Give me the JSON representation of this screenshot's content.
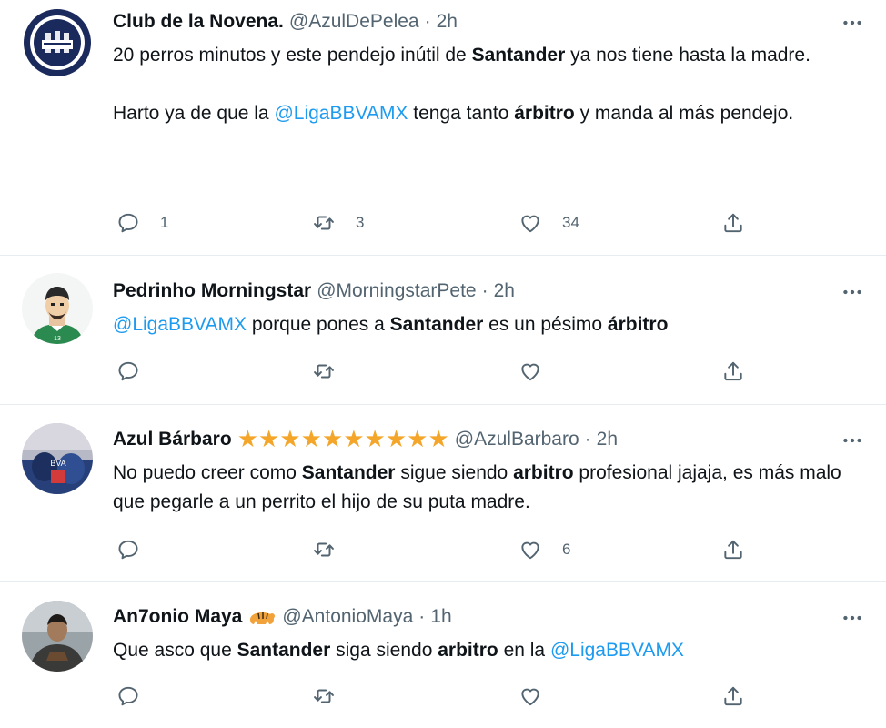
{
  "colors": {
    "text": "#0f1419",
    "secondary": "#536471",
    "link": "#1d9bf0",
    "divider": "#e6ecf0",
    "star": "#f4a62a"
  },
  "tweets": [
    {
      "name": "Club de la Novena.",
      "handle": "@AzulDePelea",
      "dot": "·",
      "time": "2h",
      "text": [
        [
          "20 perros minutos y este pendejo inútil de ",
          "Santander",
          " ya nos tiene hasta la madre."
        ],
        [
          "Harto ya de que la ",
          "@LigaBBVAMX",
          " tenga tanto ",
          "árbitro",
          " y manda al más pendejo."
        ]
      ],
      "counts": {
        "reply": "1",
        "retweet": "3",
        "like": "34"
      }
    },
    {
      "name": "Pedrinho Morningstar",
      "handle": "@MorningstarPete",
      "dot": "·",
      "time": "2h",
      "text": [
        "@LigaBBVAMX",
        " porque pones a ",
        "Santander",
        " es un pésimo ",
        "árbitro"
      ],
      "counts": {
        "reply": "",
        "retweet": "",
        "like": ""
      }
    },
    {
      "name": "Azul Bárbaro",
      "stars": "★★★★★★★★★★",
      "handle": "@AzulBarbaro",
      "dot": "·",
      "time": "2h",
      "text": [
        "No puedo creer como ",
        "Santander",
        " sigue siendo ",
        "arbitro",
        " profesional jajaja, es más malo que pegarle a un perrito el hijo de su puta madre."
      ],
      "counts": {
        "reply": "",
        "retweet": "",
        "like": "6"
      }
    },
    {
      "name": "An7onio Maya",
      "handle": "@AntonioMaya",
      "dot": "·",
      "time": "1h",
      "text": [
        "Que asco que ",
        "Santander",
        " siga siendo ",
        "arbitro",
        " en la ",
        "@LigaBBVAMX"
      ],
      "counts": {
        "reply": "",
        "retweet": "",
        "like": ""
      }
    }
  ],
  "icons": {
    "reply": "reply-icon",
    "retweet": "retweet-icon",
    "like": "heart-icon",
    "share": "share-icon",
    "more": "more-icon"
  }
}
